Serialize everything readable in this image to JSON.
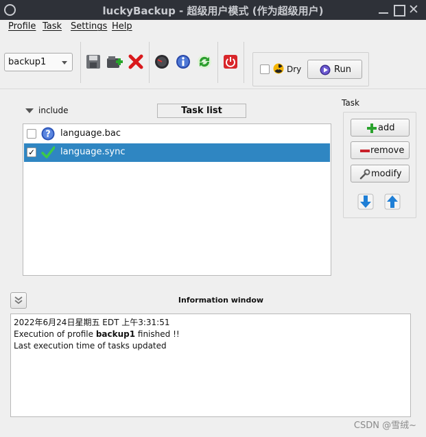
{
  "window": {
    "title": "luckyBackup - 超级用户模式 (作为超级用户)"
  },
  "menu": {
    "items": [
      {
        "label": "Profile"
      },
      {
        "label": "Task"
      },
      {
        "label": "Settings"
      },
      {
        "label": "Help"
      }
    ]
  },
  "toolbar": {
    "profile_value": "backup1",
    "dry_label": "Dry",
    "run_label": "Run"
  },
  "tasks": {
    "include_label": "include",
    "list_header": "Task list",
    "rows": [
      {
        "name": "language.bac",
        "checked": false,
        "selected": false,
        "icon": "question-icon"
      },
      {
        "name": "language.sync",
        "checked": true,
        "selected": true,
        "icon": "checkmark-icon"
      }
    ]
  },
  "task_panel": {
    "group_label": "Task",
    "add_label": "add",
    "remove_label": "remove",
    "modify_label": "modify"
  },
  "info": {
    "title": "Information window",
    "line1": "2022年6月24日星期五 EDT 上午3:31:51",
    "line2_prefix": "Execution of profile ",
    "line2_profile": "backup1",
    "line2_suffix": " finished !!",
    "line3": "Last execution time of tasks updated"
  },
  "watermark": "CSDN @雪绒~",
  "colors": {
    "titlebar": "#2e3138",
    "selection": "#2f86c2",
    "window_bg": "#efefef"
  }
}
